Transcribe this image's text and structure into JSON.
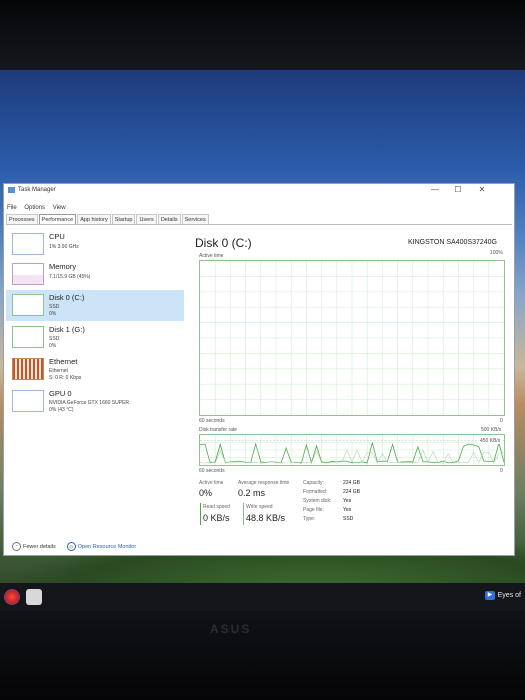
{
  "window": {
    "title": "Task Manager",
    "menu": [
      "File",
      "Options",
      "View"
    ],
    "tabs": [
      "Processes",
      "Performance",
      "App history",
      "Startup",
      "Users",
      "Details",
      "Services"
    ],
    "active_tab": "Performance",
    "controls": {
      "minimize": "—",
      "maximize": "☐",
      "close": "✕"
    }
  },
  "sidebar": [
    {
      "title": "CPU",
      "sub1": "1% 3.90 GHz",
      "sub2": "",
      "sub3": ""
    },
    {
      "title": "Memory",
      "sub1": "7.1/15.9 GB (45%)",
      "sub2": "",
      "sub3": ""
    },
    {
      "title": "Disk 0 (C:)",
      "sub1": "SSD",
      "sub2": "0%",
      "sub3": ""
    },
    {
      "title": "Disk 1 (G:)",
      "sub1": "SSD",
      "sub2": "0%",
      "sub3": ""
    },
    {
      "title": "Ethernet",
      "sub1": "Ethernet",
      "sub2": "S: 0 R: 0 Kbps",
      "sub3": ""
    },
    {
      "title": "GPU 0",
      "sub1": "NVIDIA GeForce GTX 1660 SUPER",
      "sub2": "0% (43 °C)",
      "sub3": ""
    }
  ],
  "main": {
    "title": "Disk 0 (C:)",
    "model": "KINGSTON SA400S37240G",
    "active_time_label": "Active time",
    "active_time_max": "100%",
    "graph1_x_left": "60 seconds",
    "graph1_x_right": "0",
    "transfer_label": "Disk transfer rate",
    "transfer_max": "500 KB/s",
    "transfer_line": "450 KB/s",
    "graph2_x_left": "60 seconds",
    "graph2_x_right": "0"
  },
  "stats": {
    "active_time": {
      "label": "Active time",
      "value": "0%"
    },
    "avg_response": {
      "label": "Average response time",
      "value": "0.2 ms"
    },
    "read_speed": {
      "label": "Read speed",
      "value": "0 KB/s"
    },
    "write_speed": {
      "label": "Write speed",
      "value": "48.8 KB/s"
    }
  },
  "properties": [
    {
      "key": "Capacity:",
      "value": "224 GB"
    },
    {
      "key": "Formatted:",
      "value": "224 GB"
    },
    {
      "key": "System disk:",
      "value": "Yes"
    },
    {
      "key": "Page file:",
      "value": "Yes"
    },
    {
      "key": "Type:",
      "value": "SSD"
    }
  ],
  "footer": {
    "fewer": "Fewer details",
    "resmon": "Open Resource Monitor"
  },
  "taskbar": {
    "label": "Eyes of"
  },
  "colors": {
    "graph_line": "#4aa84a",
    "selected_bg": "#cce4f7",
    "link": "#2a62b8"
  }
}
